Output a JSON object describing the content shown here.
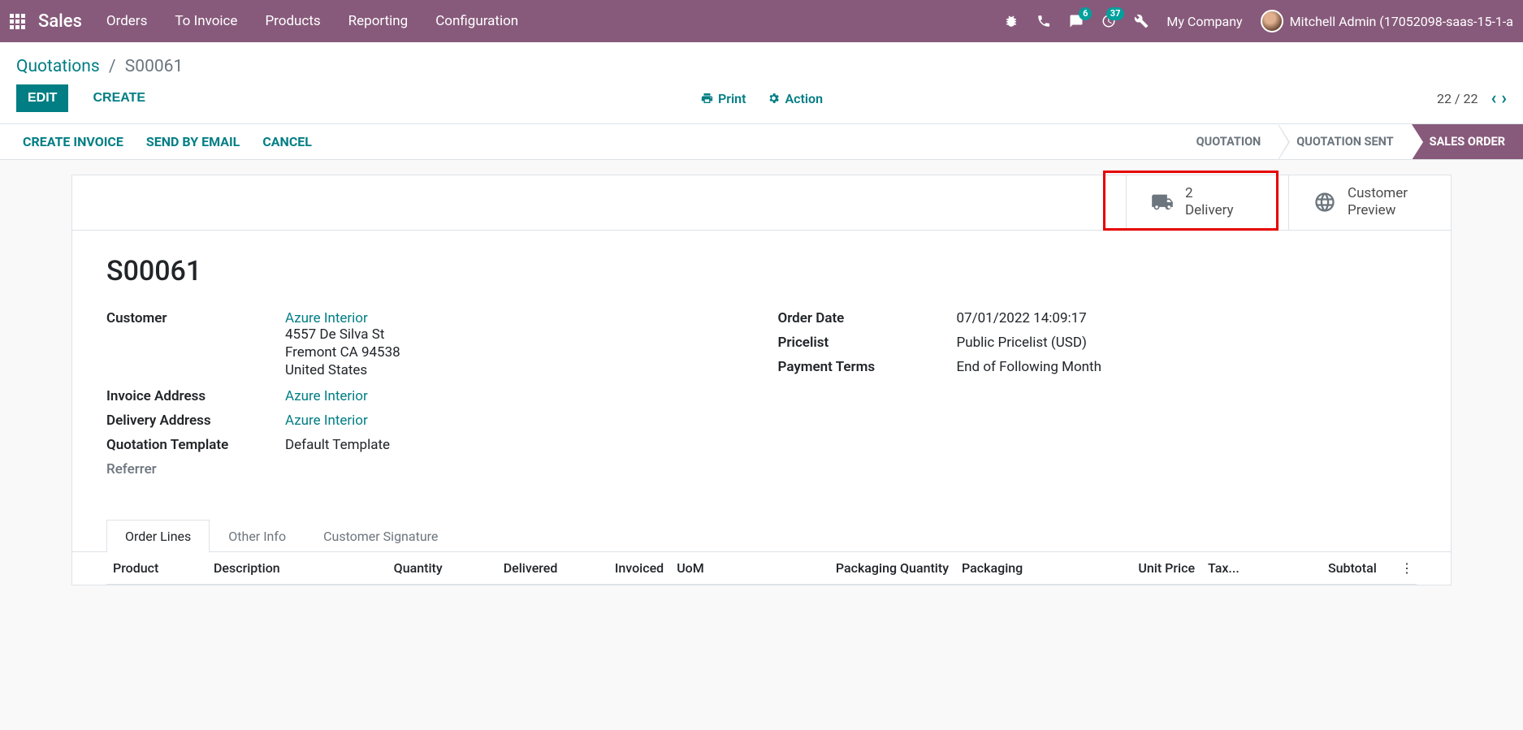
{
  "nav": {
    "brand": "Sales",
    "items": [
      "Orders",
      "To Invoice",
      "Products",
      "Reporting",
      "Configuration"
    ],
    "msg_badge": "6",
    "activity_badge": "37",
    "company": "My Company",
    "user": "Mitchell Admin (17052098-saas-15-1-a"
  },
  "breadcrumb": {
    "parent": "Quotations",
    "current": "S00061"
  },
  "buttons": {
    "edit": "EDIT",
    "create": "CREATE",
    "print": "Print",
    "action": "Action",
    "create_invoice": "CREATE INVOICE",
    "send_email": "SEND BY EMAIL",
    "cancel": "CANCEL"
  },
  "pager": {
    "text": "22 / 22"
  },
  "status_steps": [
    "QUOTATION",
    "QUOTATION SENT",
    "SALES ORDER"
  ],
  "stat_buttons": {
    "delivery": {
      "count": "2",
      "label": "Delivery"
    },
    "preview": {
      "line1": "Customer",
      "line2": "Preview"
    }
  },
  "form": {
    "title": "S00061",
    "left": {
      "customer_label": "Customer",
      "customer_name": "Azure Interior",
      "customer_addr1": "4557 De Silva St",
      "customer_addr2": "Fremont CA 94538",
      "customer_addr3": "United States",
      "invoice_addr_label": "Invoice Address",
      "invoice_addr": "Azure Interior",
      "delivery_addr_label": "Delivery Address",
      "delivery_addr": "Azure Interior",
      "template_label": "Quotation Template",
      "template": "Default Template",
      "referrer_label": "Referrer"
    },
    "right": {
      "order_date_label": "Order Date",
      "order_date": "07/01/2022 14:09:17",
      "pricelist_label": "Pricelist",
      "pricelist": "Public Pricelist (USD)",
      "payment_terms_label": "Payment Terms",
      "payment_terms": "End of Following Month"
    }
  },
  "tabs": [
    "Order Lines",
    "Other Info",
    "Customer Signature"
  ],
  "table": {
    "headers": [
      "Product",
      "Description",
      "Quantity",
      "Delivered",
      "Invoiced",
      "UoM",
      "Packaging Quantity",
      "Packaging",
      "Unit Price",
      "Tax...",
      "Subtotal"
    ]
  }
}
